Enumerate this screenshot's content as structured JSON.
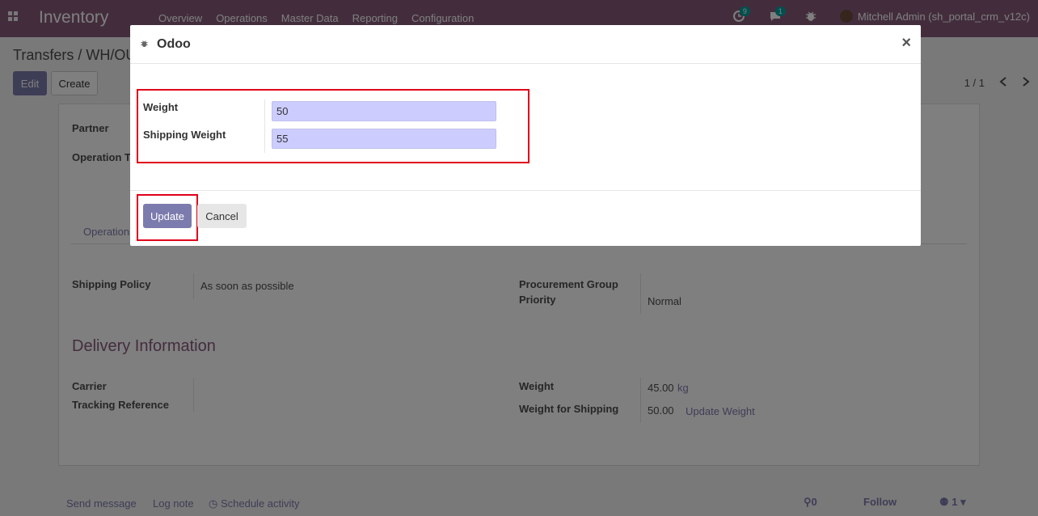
{
  "navbar": {
    "brand": "Inventory",
    "menu": [
      "Overview",
      "Operations",
      "Master Data",
      "Reporting",
      "Configuration"
    ],
    "activity_count": "9",
    "message_count": "1",
    "user": "Mitchell Admin (sh_portal_crm_v12c)"
  },
  "control_panel": {
    "breadcrumb": "Transfers / WH/OU",
    "edit_label": "Edit",
    "create_label": "Create",
    "pager": "1 / 1"
  },
  "form": {
    "partner_label": "Partner",
    "operation_type_label": "Operation T",
    "tab_operations": "Operations",
    "shipping_policy_label": "Shipping Policy",
    "shipping_policy_value": "As soon as possible",
    "procurement_group_label": "Procurement Group",
    "priority_label": "Priority",
    "priority_value": "Normal",
    "delivery_title": "Delivery Information",
    "carrier_label": "Carrier",
    "tracking_label": "Tracking Reference",
    "weight_label": "Weight",
    "weight_value": "45.00",
    "weight_unit": "kg",
    "weight_shipping_label": "Weight for Shipping",
    "weight_shipping_value": "50.00",
    "update_weight_link": "Update Weight"
  },
  "chatter": {
    "send_message": "Send message",
    "log_note": "Log note",
    "schedule_activity": "Schedule activity",
    "attachments": "0",
    "follow": "Follow",
    "followers": "1"
  },
  "modal": {
    "title": "Odoo",
    "close": "×",
    "weight_label": "Weight",
    "weight_value": "50",
    "shipping_weight_label": "Shipping Weight",
    "shipping_weight_value": "55",
    "update_label": "Update",
    "cancel_label": "Cancel"
  }
}
